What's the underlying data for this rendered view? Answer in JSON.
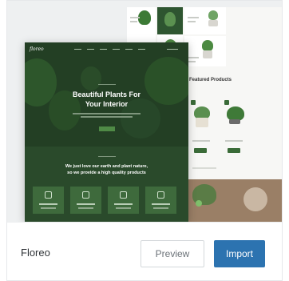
{
  "template": {
    "name": "Floreo",
    "preview_label": "Preview",
    "import_label": "Import",
    "accent_color": "#2c73b0",
    "theme_color": "#1f3a20"
  },
  "preview_image": {
    "logo": "floreo",
    "hero_title_line1": "Beautiful Plants For",
    "hero_title_line2": "Your Interior",
    "mid_title_line1": "We just love our earth and plant nature,",
    "mid_title_line2": "so we provide a high quality products",
    "featured_title": "Featured Products"
  }
}
